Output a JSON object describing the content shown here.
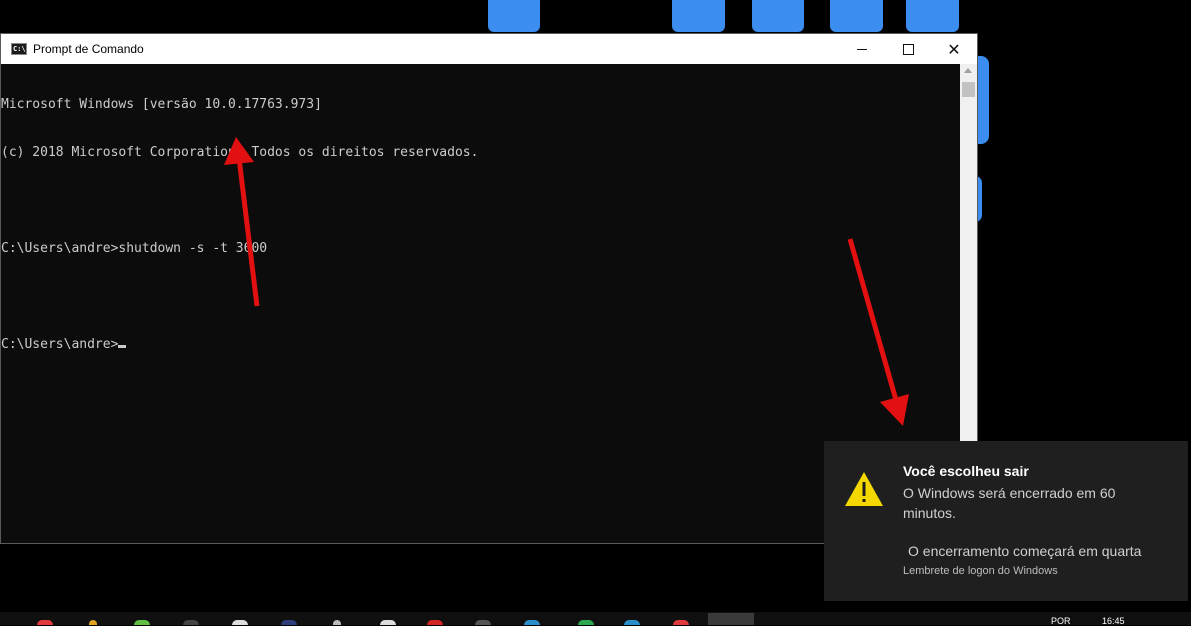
{
  "window": {
    "title": "Prompt de Comando",
    "icon": "cmd-icon",
    "icon_text": "C:\\"
  },
  "console": {
    "lines": [
      "Microsoft Windows [versão 10.0.17763.973]",
      "(c) 2018 Microsoft Corporation. Todos os direitos reservados.",
      "",
      "C:\\Users\\andre>shutdown -s -t 3600",
      "",
      "C:\\Users\\andre>"
    ]
  },
  "toast": {
    "icon": "warning-icon",
    "title": "Você escolheu sair",
    "message": "O Windows será encerrado em 60 minutos.",
    "subtext": "O encerramento começará em quarta",
    "source": "Lembrete de logon do Windows"
  },
  "taskbar": {
    "language": "POR",
    "clock": "16:45"
  },
  "colors": {
    "console_bg": "#0c0c0c",
    "console_text": "#cccccc",
    "annotation_arrow": "#e21010",
    "toast_bg": "#1f1f1f",
    "warning_yellow": "#f5d800",
    "desktop_tile": "#3b8df0"
  }
}
